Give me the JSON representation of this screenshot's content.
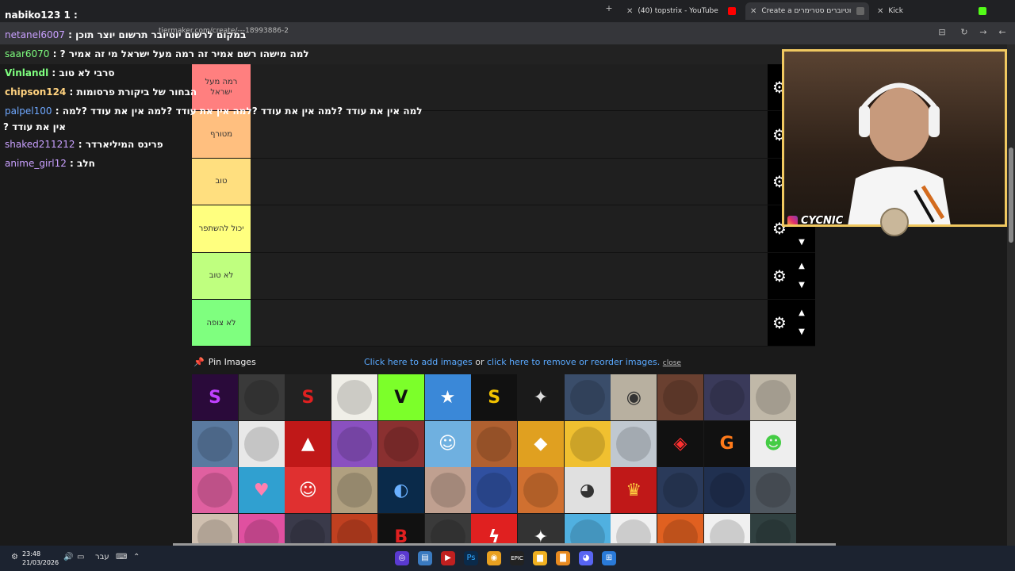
{
  "browser": {
    "tabs": [
      {
        "label": "(40) topstrix - YouTube",
        "favicon_color": "#ff0000"
      },
      {
        "label": "Create a יוטיוברים סטרימרים Tier",
        "favicon_color": "#666666"
      },
      {
        "label": "Kick",
        "favicon_color": "#53fc18"
      }
    ],
    "url": "tiermaker.com/create/---18993886-2"
  },
  "tiers": [
    {
      "label": "רמה מעל ישראל",
      "color": "#ff7f7f"
    },
    {
      "label": "מטורף",
      "color": "#ffbf7f"
    },
    {
      "label": "טוב",
      "color": "#ffdf7f"
    },
    {
      "label": "יכול להשתפר",
      "color": "#ffff7f"
    },
    {
      "label": "לא טוב",
      "color": "#bfff7f"
    },
    {
      "label": "לא צופה",
      "color": "#7fff7f"
    }
  ],
  "pin_label": "Pin Images",
  "add_links": {
    "add": "Click here to add images",
    "or": "or",
    "remove": "click here to remove or reorder images.",
    "close": "close"
  },
  "chat": [
    {
      "user": "nabiko123",
      "text": "1 :",
      "color": "#ffffff"
    },
    {
      "user": "netanel6007",
      "text": ": במקום לרשום יוטיובר תרשום יוצר תוכן",
      "color": "#c9a0ff"
    },
    {
      "user": "saar6070",
      "text": ": ? למה מישהו רשם אמיר זה רמה מעל ישראל מי זה אמיר",
      "color": "#7fff7f"
    },
    {
      "user": "Vinlandl",
      "text": ": סרבי לא טוב",
      "color": "#7fff7f"
    },
    {
      "user": "chipson124",
      "text": ": הבחור של ביקורת פרסומות",
      "color": "#ffd27f"
    },
    {
      "user": "palpel100",
      "text": ": למה אין את עודד ?למה אין את עודד ?למה אין את עודד ?למה אין את עודד ?למה",
      "color": "#6fa8ff"
    },
    {
      "user": "",
      "text": "? אין את עודד",
      "color": "#ffffff"
    },
    {
      "user": "shaked211212",
      "text": ": פרינס המיליארדר",
      "color": "#c9a0ff"
    },
    {
      "user": "anime_girl12",
      "text": ": חלב",
      "color": "#c9a0ff"
    }
  ],
  "webcam": {
    "handle": "CYCNIC"
  },
  "taskbar": {
    "time": "23:48",
    "date": "21/03/2026",
    "lang": "עבר"
  },
  "grid_cells": [
    {
      "bg": "#2a0a3a",
      "fg": "#c040ff",
      "glyph": "S"
    },
    {
      "bg": "#3a3a3a",
      "fg": "#ddd",
      "glyph": ""
    },
    {
      "bg": "#222",
      "fg": "#e02020",
      "glyph": "S"
    },
    {
      "bg": "#f0efe8",
      "fg": "#444",
      "glyph": ""
    },
    {
      "bg": "#7cff2a",
      "fg": "#111",
      "glyph": "V"
    },
    {
      "bg": "#3a88d8",
      "fg": "#fff",
      "glyph": "★"
    },
    {
      "bg": "#111",
      "fg": "#f2c200",
      "glyph": "S"
    },
    {
      "bg": "#1a1a1a",
      "fg": "#ddd",
      "glyph": "✦"
    },
    {
      "bg": "#3a4d6a",
      "fg": "#ddd",
      "glyph": ""
    },
    {
      "bg": "#b8b0a0",
      "fg": "#333",
      "glyph": "◉"
    },
    {
      "bg": "#6a4030",
      "fg": "#f0e0c0",
      "glyph": ""
    },
    {
      "bg": "#3a3a5a",
      "fg": "#ddd",
      "glyph": ""
    },
    {
      "bg": "#c0b8a8",
      "fg": "#333",
      "glyph": ""
    },
    {
      "bg": "#5a7aa0",
      "fg": "#fff",
      "glyph": ""
    },
    {
      "bg": "#e8e8e8",
      "fg": "#444",
      "glyph": ""
    },
    {
      "bg": "#c01818",
      "fg": "#fff",
      "glyph": "▲"
    },
    {
      "bg": "#8a50c0",
      "fg": "#fff",
      "glyph": ""
    },
    {
      "bg": "#8a3030",
      "fg": "#fff",
      "glyph": ""
    },
    {
      "bg": "#6fb0e0",
      "fg": "#fff",
      "glyph": "☺"
    },
    {
      "bg": "#b06030",
      "fg": "#fff",
      "glyph": ""
    },
    {
      "bg": "#e0a020",
      "fg": "#fff",
      "glyph": "◆"
    },
    {
      "bg": "#f0c030",
      "fg": "#333",
      "glyph": ""
    },
    {
      "bg": "#c0c8d0",
      "fg": "#333",
      "glyph": ""
    },
    {
      "bg": "#111",
      "fg": "#ff3030",
      "glyph": "◈"
    },
    {
      "bg": "#111",
      "fg": "#ff7a1a",
      "glyph": "G"
    },
    {
      "bg": "#eee",
      "fg": "#4c4",
      "glyph": "☻"
    },
    {
      "bg": "#e060a0",
      "fg": "#fff",
      "glyph": ""
    },
    {
      "bg": "#30a0d0",
      "fg": "#ff80b0",
      "glyph": "♥"
    },
    {
      "bg": "#e03030",
      "fg": "#fff",
      "glyph": "☺"
    },
    {
      "bg": "#b0a080",
      "fg": "#222",
      "glyph": ""
    },
    {
      "bg": "#0a2a4a",
      "fg": "#6ab0ff",
      "glyph": "◐"
    },
    {
      "bg": "#c0a090",
      "fg": "#333",
      "glyph": ""
    },
    {
      "bg": "#3050a0",
      "fg": "#fff",
      "glyph": ""
    },
    {
      "bg": "#d07030",
      "fg": "#fff",
      "glyph": ""
    },
    {
      "bg": "#e0e0e0",
      "fg": "#333",
      "glyph": "◕"
    },
    {
      "bg": "#c01818",
      "fg": "#ffd040",
      "glyph": "♛"
    },
    {
      "bg": "#2a3a5a",
      "fg": "#ddd",
      "glyph": ""
    },
    {
      "bg": "#203050",
      "fg": "#ddd",
      "glyph": ""
    },
    {
      "bg": "#505860",
      "fg": "#ddd",
      "glyph": ""
    },
    {
      "bg": "#d0c0b0",
      "fg": "#333",
      "glyph": ""
    },
    {
      "bg": "#e050a0",
      "fg": "#fff",
      "glyph": ""
    },
    {
      "bg": "#3a3a4a",
      "fg": "#ddd",
      "glyph": ""
    },
    {
      "bg": "#c04020",
      "fg": "#fff",
      "glyph": ""
    },
    {
      "bg": "#111",
      "fg": "#e02020",
      "glyph": "B"
    },
    {
      "bg": "#3a3a3a",
      "fg": "#ddd",
      "glyph": ""
    },
    {
      "bg": "#e02020",
      "fg": "#fff",
      "glyph": "ϟ"
    },
    {
      "bg": "#333",
      "fg": "#fff",
      "glyph": "✦"
    },
    {
      "bg": "#50b0e0",
      "fg": "#fff",
      "glyph": ""
    },
    {
      "bg": "#f0f0f0",
      "fg": "#333",
      "glyph": ""
    },
    {
      "bg": "#e06020",
      "fg": "#fff",
      "glyph": ""
    },
    {
      "bg": "#f0f0f0",
      "fg": "#333",
      "glyph": ""
    },
    {
      "bg": "#304040",
      "fg": "#ddd",
      "glyph": ""
    }
  ]
}
